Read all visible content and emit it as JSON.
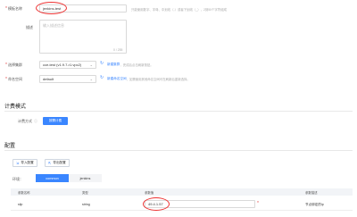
{
  "form": {
    "name": {
      "label": "模板名称",
      "value": "jenkins-test",
      "hint": "只能使用数字、字母、中划线（-）或者下划线（_），2到50个字符组成"
    },
    "desc": {
      "label": "描述",
      "placeholder": "输入描述信息",
      "counter": "0 / 255"
    },
    "cluster": {
      "label": "选择集群",
      "value": "cce-test (v1.9.7-r1.vpc2)",
      "link": "新建集群",
      "hint": "，完成后点击刷新按钮。"
    },
    "namespace": {
      "label": "命名空间",
      "value": "default",
      "link": "新建命名空间",
      "hint": "，如需使用其他命名空间可在刷新后重新选择。"
    }
  },
  "billing": {
    "title": "计费模式",
    "label": "计费方式",
    "button": "按需计费"
  },
  "config": {
    "title": "配置",
    "import_button": "导入配置",
    "export_button": "导出配置",
    "env_label": "环境：",
    "tabs": [
      "common",
      "jenkins"
    ],
    "active_tab": "common",
    "table": {
      "headers": [
        "参数名称",
        "类型",
        "参数值",
        "参数描述"
      ],
      "rows": [
        {
          "name": "slip",
          "type": "string",
          "value": "49.4.1.57",
          "desc": "节点绑定的ip"
        }
      ]
    }
  },
  "icons": {
    "required": "asterisk",
    "refresh": "refresh-icon",
    "help": "question-circle-icon",
    "import": "import-icon",
    "export": "export-icon",
    "dropdown": "chevron-down-icon"
  },
  "colors": {
    "accent": "#3a86ff",
    "required": "#e64b4b",
    "annotation": "#e33333"
  }
}
